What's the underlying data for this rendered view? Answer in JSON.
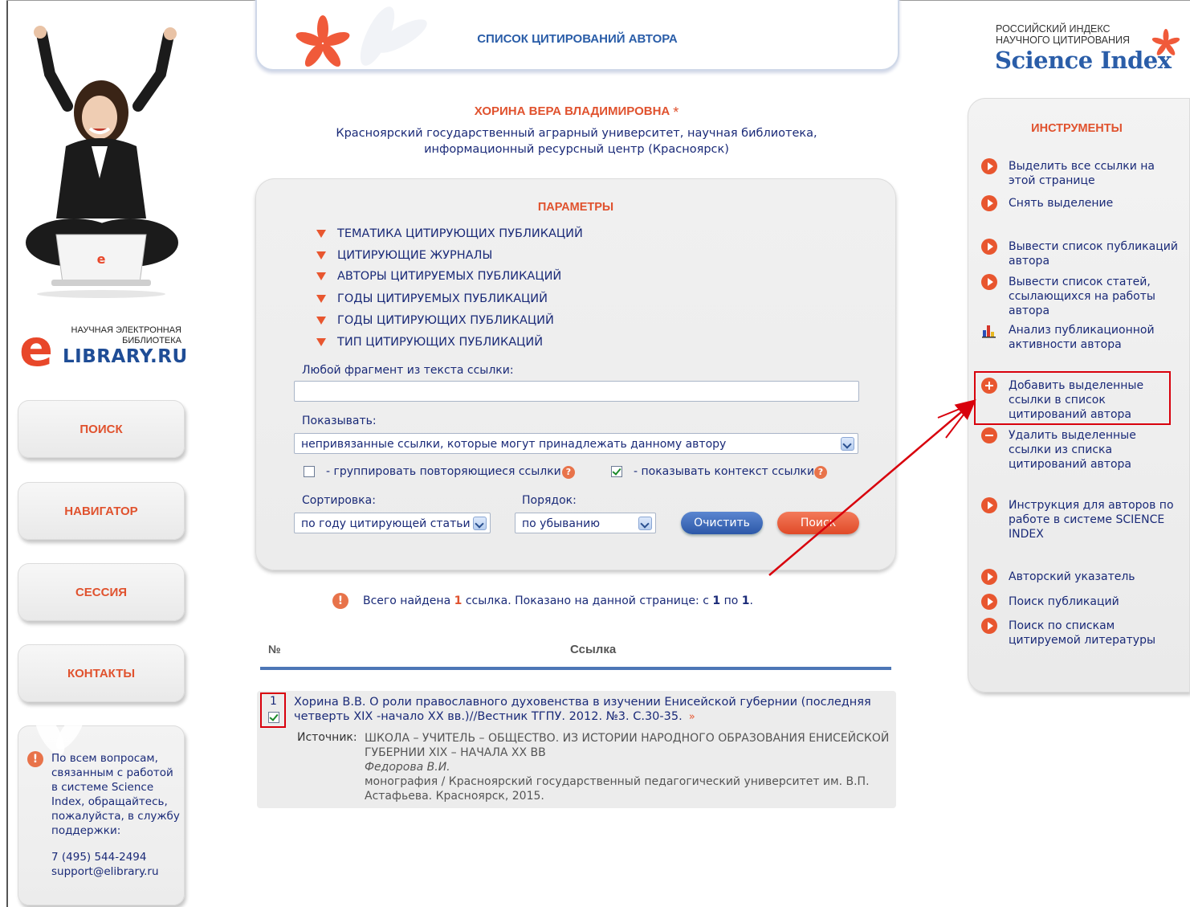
{
  "header": {
    "banner_title": "СПИСОК ЦИТИРОВАНИЙ АВТОРА"
  },
  "author": {
    "name": "ХОРИНА ВЕРА ВЛАДИМИРОВНА",
    "marker": "*",
    "org": "Красноярский государственный аграрный университет, научная библиотека, информационный ресурсный центр (Красноярск)"
  },
  "elibrary_logo": {
    "subtitle": "НАУЧНАЯ ЭЛЕКТРОННАЯ БИБЛИОТЕКА",
    "name": "LIBRARY.RU",
    "letter": "e"
  },
  "left_nav": [
    "ПОИСК",
    "НАВИГАТОР",
    "СЕССИЯ",
    "КОНТАКТЫ"
  ],
  "support": {
    "text": "По всем вопросам, связанным с работой в системе Science Index, обращайтесь, пожалуйста, в службу поддержки:",
    "phone": "7 (495) 544-2494",
    "email": "support@elibrary.ru"
  },
  "params": {
    "title": "ПАРАМЕТРЫ",
    "items": [
      "ТЕМАТИКА ЦИТИРУЮЩИХ ПУБЛИКАЦИЙ",
      "ЦИТИРУЮЩИЕ ЖУРНАЛЫ",
      "АВТОРЫ ЦИТИРУЕМЫХ ПУБЛИКАЦИЙ",
      "ГОДЫ ЦИТИРУЕМЫХ ПУБЛИКАЦИЙ",
      "ГОДЫ ЦИТИРУЮЩИХ ПУБЛИКАЦИЙ",
      "ТИП ЦИТИРУЮЩИХ ПУБЛИКАЦИЙ"
    ],
    "fragment_label": "Любой фрагмент из текста ссылки:",
    "fragment_value": "",
    "show_label": "Показывать:",
    "show_value": "непривязанные ссылки, которые могут принадлежать данному автору",
    "group_label": "- группировать повторяющиеся ссылки",
    "group_checked": false,
    "context_label": "- показывать контекст ссылки",
    "context_checked": true,
    "help_glyph": "?",
    "sort_label": "Сортировка:",
    "sort_value": "по году цитирующей статьи",
    "order_label": "Порядок:",
    "order_value": "по убыванию",
    "clear_button": "Очистить",
    "search_button": "Поиск"
  },
  "results": {
    "info_prefix": "Всего найдена",
    "count": "1",
    "info_mid": "ссылка. Показано на данной странице: с",
    "from": "1",
    "info_to": "по",
    "to": "1",
    "info_end": ".",
    "col_no": "№",
    "col_link": "Ссылка",
    "items": [
      {
        "num": "1",
        "checked": true,
        "text": "Хорина В.В. О роли православного духовенства в изучении Енисейской губернии (последняя четверть XIX -начало XX вв.)//Вестник ТГПУ. 2012. №3. С.30-35.",
        "more": "»",
        "source_label": "Источник:",
        "source_title": "ШКОЛА – УЧИТЕЛЬ – ОБЩЕСТВО. ИЗ ИСТОРИИ НАРОДНОГО ОБРАЗОВАНИЯ ЕНИСЕЙСКОЙ ГУБЕРНИИ XIX – НАЧАЛА XX ВВ",
        "source_author": "Федорова В.И.",
        "source_pub": "монография / Красноярский государственный педагогический университет им. В.П. Астафьева. Красноярск, 2015."
      }
    ]
  },
  "science_index": {
    "small_line1": "РОССИЙСКИЙ ИНДЕКС",
    "small_line2": "НАУЧНОГО ЦИТИРОВАНИЯ",
    "big": "Science Index"
  },
  "tools": {
    "title": "ИНСТРУМЕНТЫ",
    "items": [
      {
        "label": "Выделить все ссылки на этой странице",
        "icon": "play-icon"
      },
      {
        "label": "Снять выделение",
        "icon": "play-icon"
      },
      {
        "label": "Вывести список публикаций автора",
        "icon": "play-icon"
      },
      {
        "label": "Вывести список статей, ссылающихся на работы автора",
        "icon": "play-icon"
      },
      {
        "label": "Анализ публикационной активности автора",
        "icon": "bar-chart-icon"
      },
      {
        "label": "Добавить выделенные ссылки в список цитирований автора",
        "icon": "plus-icon"
      },
      {
        "label": "Удалить выделенные ссылки из списка цитирований автора",
        "icon": "minus-icon"
      },
      {
        "label": "Инструкция для авторов по работе в системе SCIENCE INDEX",
        "icon": "play-icon"
      },
      {
        "label": "Авторский указатель",
        "icon": "play-icon"
      },
      {
        "label": "Поиск публикаций",
        "icon": "play-icon"
      },
      {
        "label": "Поиск по спискам цитируемой литературы",
        "icon": "play-icon"
      }
    ]
  },
  "colors": {
    "accent_orange": "#e0522e",
    "text_blue": "#1a2a78",
    "highlight_red": "#d8000c",
    "rule_blue": "#4d76b6"
  }
}
